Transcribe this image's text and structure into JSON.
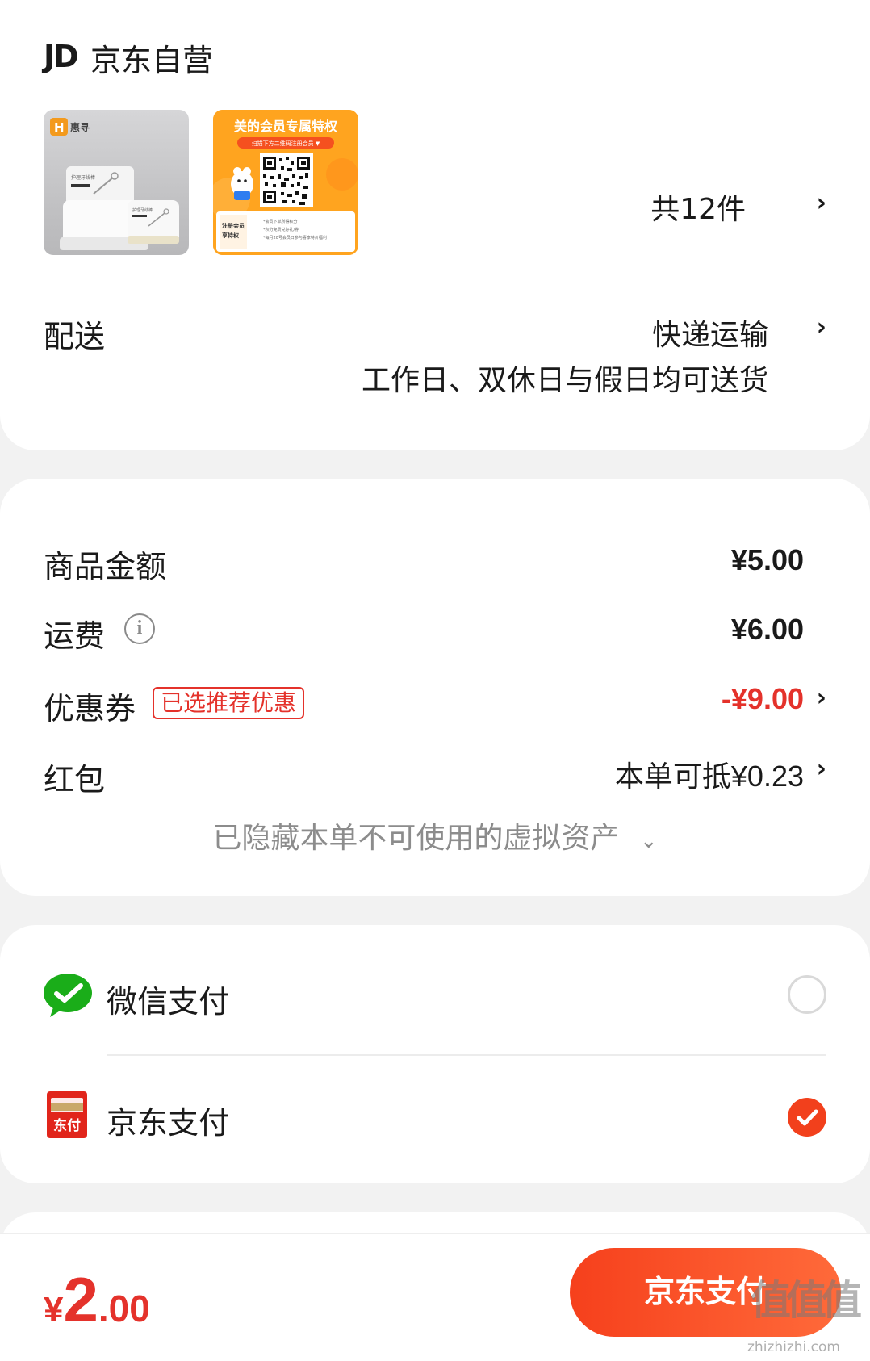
{
  "store": {
    "logo_text": "JD",
    "name": "京东自营",
    "items_count_label": "共12件"
  },
  "thumbs": {
    "item1": {
      "brand": "惠寻",
      "box_label_1": "护理牙线棒",
      "box_label_2": "护理牙线棒"
    },
    "item2": {
      "title": "美的会员专属特权",
      "subtitle": "扫描下方二维码注册会员 ▼",
      "side_label_1": "注册会员",
      "side_label_2": "享特权",
      "note_1": "*会员下单所得积分",
      "note_2": "*积分免费兑好礼/券",
      "note_3": "*每月20号会员日参与喜享特价福利"
    }
  },
  "delivery": {
    "label": "配送",
    "method": "快递运输",
    "note": "工作日、双休日与假日均可送货"
  },
  "price": {
    "goods_label": "商品金额",
    "goods_value": "¥5.00",
    "shipping_label": "运费",
    "shipping_value": "¥6.00",
    "coupon_label": "优惠券",
    "coupon_tag": "已选推荐优惠",
    "coupon_value": "-¥9.00",
    "redpacket_label": "红包",
    "redpacket_value": "本单可抵¥0.23",
    "hidden_assets": "已隐藏本单不可使用的虚拟资产"
  },
  "payment": {
    "wechat_label": "微信支付",
    "jdpay_label": "京东支付",
    "jdpay_icon_text": "东付",
    "selected": "jdpay"
  },
  "bottom": {
    "currency": "¥",
    "total_int": "2",
    "total_dec": ".00",
    "pay_button": "京东支付",
    "watermark": "值值值",
    "watermark_site": "zhizhizhi.com"
  },
  "colors": {
    "accent_red": "#e4322b",
    "button_orange": "#f6401c",
    "wechat_green": "#1aad19",
    "background": "#f2f2f2"
  }
}
